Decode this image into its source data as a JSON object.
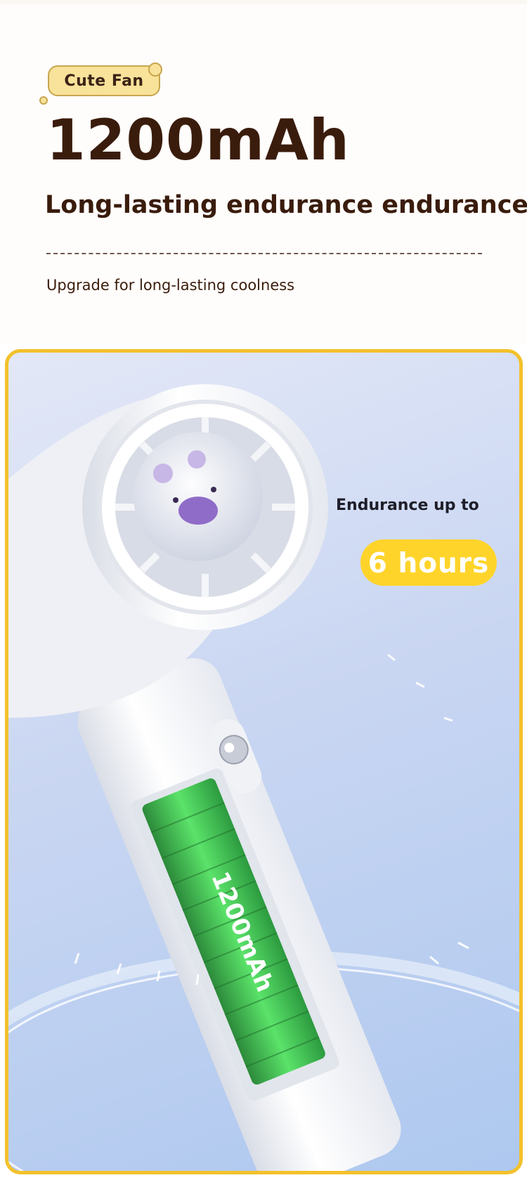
{
  "tag": {
    "label": "Cute Fan"
  },
  "headline": "1200mAh",
  "subheadline": "Long-lasting endurance endurance",
  "caption": "Upgrade for long-lasting coolness",
  "product": {
    "endurance_label": "Endurance up to",
    "endurance_value": "6 hours",
    "battery_label": "1200mAh"
  },
  "colors": {
    "accent": "#f3c12b",
    "text": "#3a1c0c",
    "pill": "#ffd42a",
    "battery": "#4fdc5a"
  }
}
